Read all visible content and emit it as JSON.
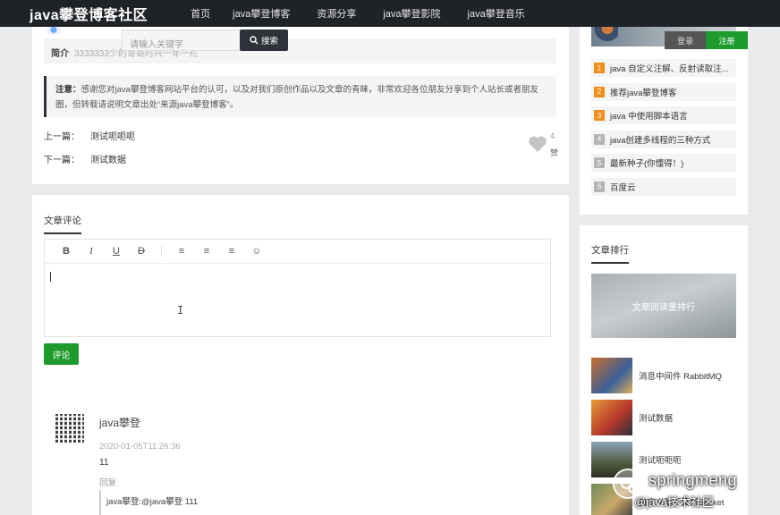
{
  "header": {
    "brand": "java攀登博客社区",
    "nav": [
      "首页",
      "java攀登博客",
      "资源分享",
      "java攀登影院",
      "java攀登音乐"
    ]
  },
  "search": {
    "placeholder": "请输入关键字",
    "button": "搜索"
  },
  "article": {
    "intro_label": "简介",
    "intro_text": "3333333少的哥哥时兴一年一栏",
    "notice_label": "注意：",
    "notice_text": "感谢您对java攀登博客网站平台的认可，以及对我们原创作品以及文章的青睐，非常欢迎各位朋友分享到个人站长或者朋友圈，但转载请说明文章出处“来源java攀登博客”。",
    "prev_label": "上一篇：",
    "prev_title": "测试呃呃呃",
    "next_label": "下一篇：",
    "next_title": "测试数据",
    "like_count": "4",
    "like_label": "赞"
  },
  "comments": {
    "title": "文章评论",
    "toolbar": [
      "B",
      "I",
      "U",
      "D",
      "≡",
      "≡",
      "≡",
      "☺"
    ],
    "submit": "评论",
    "items": [
      {
        "author": "java攀登",
        "time": "2020-01-05T11:26:36",
        "text": "11",
        "reply_label": "回复",
        "quote": "java攀登:@java攀登  111"
      }
    ]
  },
  "sidebar": {
    "login": "登录",
    "register": "注册",
    "hot": [
      {
        "num": "1",
        "title": "java 自定义注解、反射读取注..."
      },
      {
        "num": "2",
        "title": "推荐java攀登博客"
      },
      {
        "num": "3",
        "title": "java 中使用脚本语言"
      },
      {
        "num": "4",
        "title": "java创建多线程的三种方式"
      },
      {
        "num": "5",
        "title": "最新种子(你懂得！)"
      },
      {
        "num": "6",
        "title": "百度云"
      }
    ],
    "rank_title": "文章排行",
    "rank_banner": "文章阅读量排行",
    "rank": [
      {
        "title": "消息中间件 RabbitMQ"
      },
      {
        "title": "测试数据"
      },
      {
        "title": "测试呃呃呃"
      },
      {
        "title": "自定义基于反射Socket"
      }
    ]
  },
  "watermark": {
    "text": "springmeng",
    "sub": "@java技术社区"
  }
}
